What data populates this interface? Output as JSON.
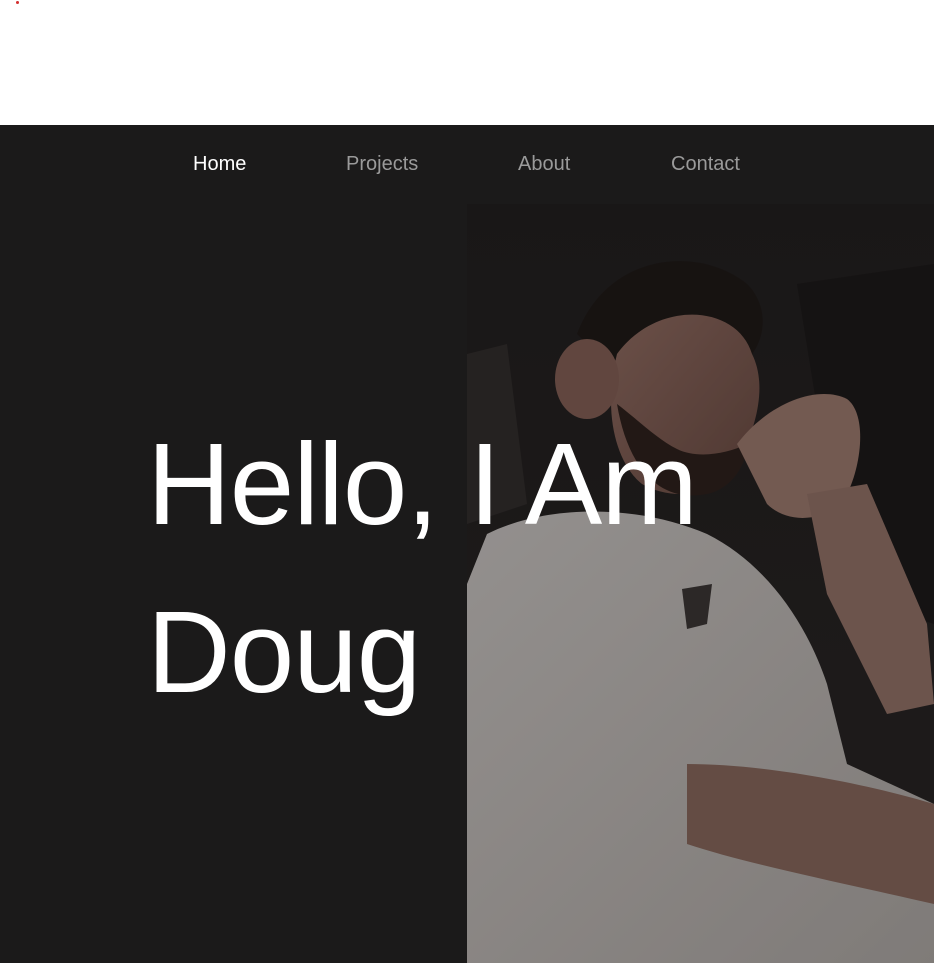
{
  "nav": {
    "items": [
      {
        "label": "Home",
        "active": true
      },
      {
        "label": "Projects",
        "active": false
      },
      {
        "label": "About",
        "active": false
      },
      {
        "label": "Contact",
        "active": false
      }
    ]
  },
  "hero": {
    "line1": "Hello, I Am",
    "line2": "Doug"
  },
  "colors": {
    "background_dark": "#1b1a1a",
    "nav_active": "#ffffff",
    "nav_inactive": "#9a9a9a",
    "headline": "#ffffff",
    "marker": "#d32f2f"
  }
}
